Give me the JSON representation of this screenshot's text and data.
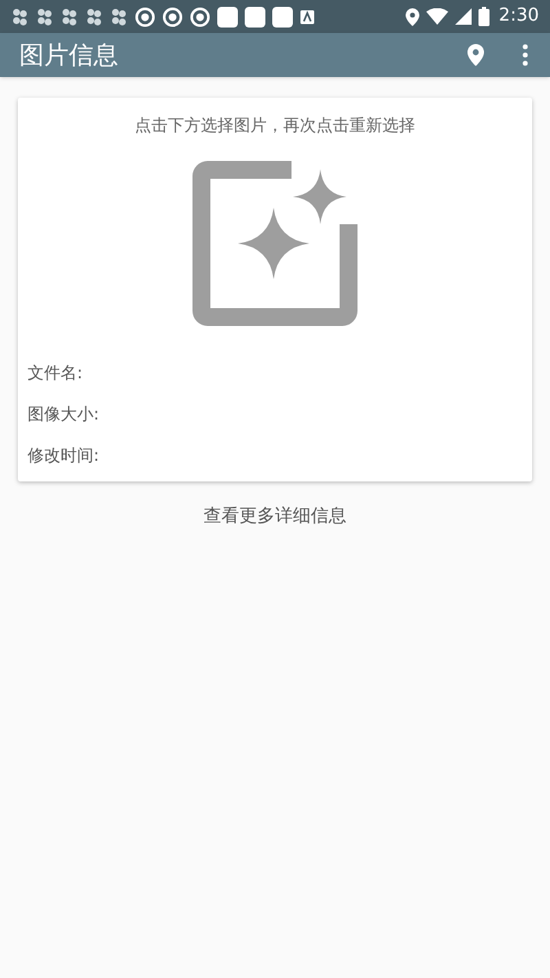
{
  "status_bar": {
    "time": "2:30"
  },
  "app_bar": {
    "title": "图片信息"
  },
  "card": {
    "hint": "点击下方选择图片，再次点击重新选择",
    "fields": [
      {
        "label": "文件名:"
      },
      {
        "label": "图像大小:"
      },
      {
        "label": "修改时间:"
      }
    ]
  },
  "more_link": "查看更多详细信息"
}
